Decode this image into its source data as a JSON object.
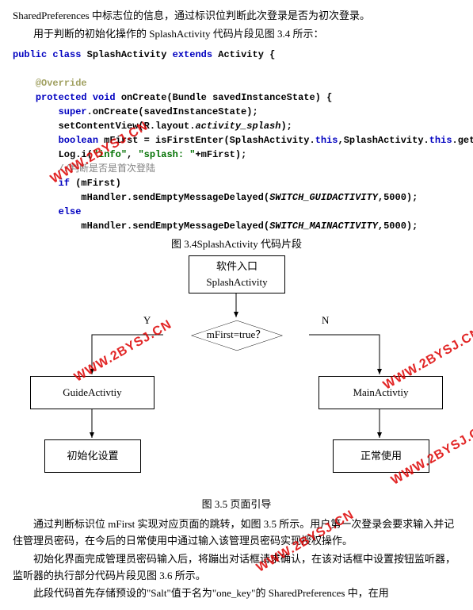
{
  "text": {
    "p1": "SharedPreferences 中标志位的信息，通过标识位判断此次登录是否为初次登录。",
    "p2": "用于判断的初始化操作的 SplashActivity 代码片段见图 3.4 所示：",
    "cap34": "图 3.4SplashActivity 代码片段",
    "cap35": "图 3.5 页面引导",
    "p3": "通过判断标识位 mFirst 实现对应页面的跳转，如图 3.5 所示。用户第一次登录会要求输入并记住管理员密码，在今后的日常使用中通过输入该管理员密码实现授权操作。",
    "p4": "初始化界面完成管理员密码输入后，将蹦出对话框请求确认，在该对话框中设置按钮监听器，监听器的执行部分代码片段见图 3.6 所示。",
    "p5": "此段代码首先存储预设的\"Salt\"值于名为\"one_key\"的 SharedPreferences 中，在用"
  },
  "code": {
    "decl_pre": "public class",
    "cls": "SplashActivity",
    "ext": "extends",
    "sup": "Activity {",
    "override": "@Override",
    "oncreate_pre": "protected void",
    "oncreate_sig": "onCreate(Bundle savedInstanceState) {",
    "super_pre": "super",
    "super_rest": ".onCreate(savedInstanceState);",
    "setcv_pre": "setContentView(R.layout.",
    "setcv_mid": "activity_splash",
    "setcv_end": ");",
    "bool_kw": "boolean",
    "bool_rest": " mFirst = isFirstEnter(SplashActivity.",
    "this1": "this",
    "bool_mid": ",SplashActivity.",
    "this2": "this",
    "bool_tail": ".getClass().getName());",
    "log_pre": "Log.i(",
    "log_s1": "\"info\"",
    "log_c1": ", ",
    "log_s2": "\"splash: \"",
    "log_tail": "+mFirst);",
    "comment": "//判断是否是首次登陆",
    "if_kw": "if",
    "if_rest": " (mFirst)",
    "mh1_pre": "mHandler.sendEmptyMessageDelayed(",
    "mh1_mid": "SWITCH_GUIDACTIVITY",
    "mh1_end": ",5000);",
    "else_kw": "else",
    "mh2_pre": "mHandler.sendEmptyMessageDelayed(",
    "mh2_mid": "SWITCH_MAINACTIVITY",
    "mh2_end": ",5000);"
  },
  "flow": {
    "entry_l1": "软件入口",
    "entry_l2": "SplashActivity",
    "cond": "mFirst=true？",
    "y": "Y",
    "n": "N",
    "guide": "GuideActivtiy",
    "main": "MainActivtiy",
    "init": "初始化设置",
    "normal": "正常使用"
  },
  "watermark": "WWW.2BYSJ.CN",
  "chart_data": {
    "type": "table",
    "description": "Flowchart logic",
    "nodes": [
      {
        "id": "entry",
        "label": "软件入口 SplashActivity",
        "type": "process"
      },
      {
        "id": "cond",
        "label": "mFirst=true？",
        "type": "decision"
      },
      {
        "id": "guide",
        "label": "GuideActivtiy",
        "type": "process"
      },
      {
        "id": "main",
        "label": "MainActivtiy",
        "type": "process"
      },
      {
        "id": "init",
        "label": "初始化设置",
        "type": "process"
      },
      {
        "id": "normal",
        "label": "正常使用",
        "type": "process"
      }
    ],
    "edges": [
      {
        "from": "entry",
        "to": "cond",
        "label": ""
      },
      {
        "from": "cond",
        "to": "guide",
        "label": "Y"
      },
      {
        "from": "cond",
        "to": "main",
        "label": "N"
      },
      {
        "from": "guide",
        "to": "init",
        "label": ""
      },
      {
        "from": "main",
        "to": "normal",
        "label": ""
      }
    ]
  }
}
